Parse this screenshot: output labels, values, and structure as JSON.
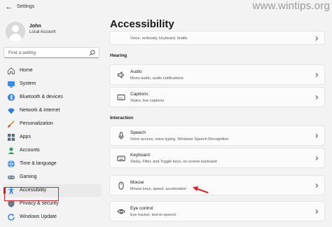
{
  "window": {
    "title": "Settings",
    "watermark": "www.wintips.org"
  },
  "user": {
    "name": "John",
    "account_type": "Local Account"
  },
  "search": {
    "placeholder": "Find a setting"
  },
  "nav": {
    "items": [
      {
        "label": "Home",
        "icon": "home-icon"
      },
      {
        "label": "System",
        "icon": "system-icon"
      },
      {
        "label": "Bluetooth & devices",
        "icon": "bluetooth-icon"
      },
      {
        "label": "Network & internet",
        "icon": "wifi-icon"
      },
      {
        "label": "Personalization",
        "icon": "brush-icon"
      },
      {
        "label": "Apps",
        "icon": "apps-icon"
      },
      {
        "label": "Accounts",
        "icon": "account-icon"
      },
      {
        "label": "Time & language",
        "icon": "globe-icon"
      },
      {
        "label": "Gaming",
        "icon": "gamepad-icon"
      },
      {
        "label": "Accessibility",
        "icon": "accessibility-icon",
        "selected": true
      },
      {
        "label": "Privacy & security",
        "icon": "shield-icon"
      },
      {
        "label": "Windows Update",
        "icon": "update-icon"
      }
    ]
  },
  "main": {
    "title": "Accessibility",
    "top_card": {
      "desc": "Voice, verbosity, keyboard, braille"
    },
    "hearing": {
      "heading": "Hearing",
      "items": [
        {
          "title": "Audio",
          "desc": "Mono audio, audio notifications",
          "icon": "speaker-icon"
        },
        {
          "title": "Captions",
          "desc": "Styles, live captions",
          "icon": "captions-icon"
        }
      ]
    },
    "interaction": {
      "heading": "Interaction",
      "items": [
        {
          "title": "Speech",
          "desc": "Voice access, voice typing, Windows Speech Recognition",
          "icon": "microphone-icon"
        },
        {
          "title": "Keyboard",
          "desc": "Sticky, Filter, and Toggle keys, on-screen keyboard",
          "icon": "keyboard-icon"
        },
        {
          "title": "Mouse",
          "desc": "Mouse keys, speed, acceleration",
          "icon": "mouse-icon"
        },
        {
          "title": "Eye control",
          "desc": "Eye tracker, text-to-speech",
          "icon": "eye-icon"
        }
      ]
    }
  },
  "colors": {
    "accent": "#005fb8",
    "annotation_red": "#e0202a"
  }
}
